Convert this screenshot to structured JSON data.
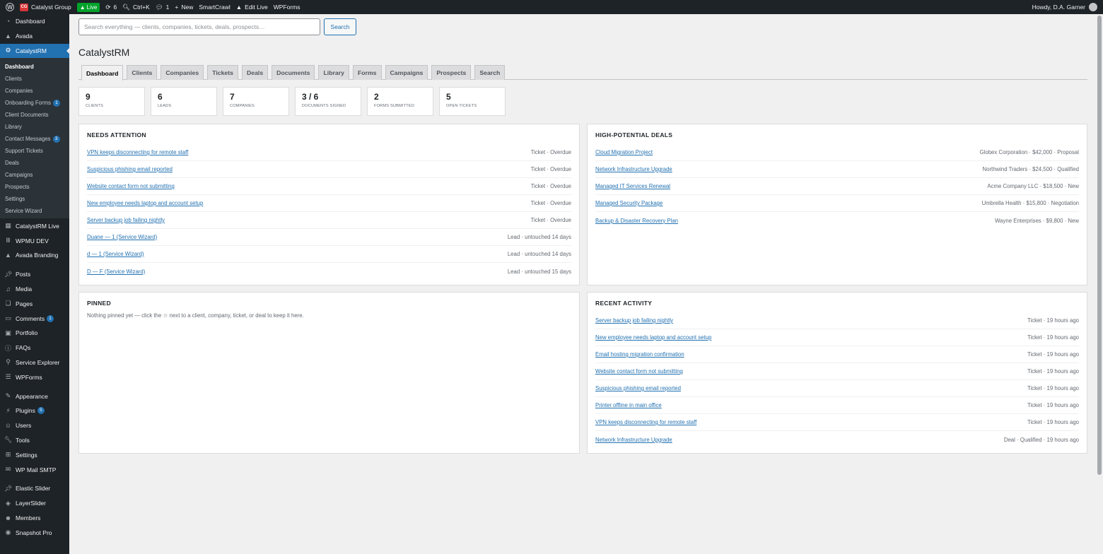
{
  "adminbar": {
    "site_name": "Catalyst Group",
    "live_label": "Live",
    "updates_count": "6",
    "shortcut_label": "Ctrl+K",
    "comments_count": "1",
    "new_label": "New",
    "smartcrawl_label": "SmartCrawl",
    "edit_live_label": "Edit Live",
    "wpforms_label": "WPForms",
    "howdy": "Howdy, D.A. Garner"
  },
  "menu": {
    "dashboard": "Dashboard",
    "avada": "Avada",
    "catalystrm": "CatalystRM",
    "submenu": [
      {
        "label": "Dashboard",
        "badge": ""
      },
      {
        "label": "Clients",
        "badge": ""
      },
      {
        "label": "Companies",
        "badge": ""
      },
      {
        "label": "Onboarding Forms",
        "badge": "1"
      },
      {
        "label": "Client Documents",
        "badge": ""
      },
      {
        "label": "Library",
        "badge": ""
      },
      {
        "label": "Contact Messages",
        "badge": "3"
      },
      {
        "label": "Support Tickets",
        "badge": ""
      },
      {
        "label": "Deals",
        "badge": ""
      },
      {
        "label": "Campaigns",
        "badge": ""
      },
      {
        "label": "Prospects",
        "badge": ""
      },
      {
        "label": "Settings",
        "badge": ""
      },
      {
        "label": "Service Wizard",
        "badge": ""
      }
    ],
    "group1": [
      {
        "label": "CatalystRM Live",
        "icon": "grid-icon"
      },
      {
        "label": "WPMU DEV",
        "icon": "wpmudev-icon"
      },
      {
        "label": "Avada Branding",
        "icon": "avada-icon"
      }
    ],
    "group2": [
      {
        "label": "Posts",
        "icon": "pin-icon",
        "badge": ""
      },
      {
        "label": "Media",
        "icon": "media-icon",
        "badge": ""
      },
      {
        "label": "Pages",
        "icon": "pages-icon",
        "badge": ""
      },
      {
        "label": "Comments",
        "icon": "comments-icon",
        "badge": "1"
      },
      {
        "label": "Portfolio",
        "icon": "portfolio-icon",
        "badge": ""
      },
      {
        "label": "FAQs",
        "icon": "faq-icon",
        "badge": ""
      },
      {
        "label": "Service Explorer",
        "icon": "sitemap-icon",
        "badge": ""
      },
      {
        "label": "WPForms",
        "icon": "forms-icon",
        "badge": ""
      }
    ],
    "group3": [
      {
        "label": "Appearance",
        "icon": "brush-icon",
        "badge": ""
      },
      {
        "label": "Plugins",
        "icon": "plugin-icon",
        "badge": "5"
      },
      {
        "label": "Users",
        "icon": "users-icon",
        "badge": ""
      },
      {
        "label": "Tools",
        "icon": "wrench-icon",
        "badge": ""
      },
      {
        "label": "Settings",
        "icon": "settings-icon",
        "badge": ""
      },
      {
        "label": "WP Mail SMTP",
        "icon": "mail-icon",
        "badge": ""
      }
    ],
    "group4": [
      {
        "label": "Elastic Slider",
        "icon": "pin-icon"
      },
      {
        "label": "LayerSlider",
        "icon": "layers-icon"
      },
      {
        "label": "Members",
        "icon": "members-icon"
      },
      {
        "label": "Snapshot Pro",
        "icon": "snapshot-icon"
      }
    ]
  },
  "search": {
    "placeholder": "Search everything — clients, companies, tickets, deals, prospects…",
    "button": "Search"
  },
  "page_title": "CatalystRM",
  "tabs": [
    "Dashboard",
    "Clients",
    "Companies",
    "Tickets",
    "Deals",
    "Documents",
    "Library",
    "Forms",
    "Campaigns",
    "Prospects",
    "Search"
  ],
  "stats": [
    {
      "value": "9",
      "label": "Clients"
    },
    {
      "value": "6",
      "label": "Leads"
    },
    {
      "value": "7",
      "label": "Companies"
    },
    {
      "value": "3 / 6",
      "label": "Documents signed"
    },
    {
      "value": "2",
      "label": "Forms submitted"
    },
    {
      "value": "5",
      "label": "Open tickets"
    }
  ],
  "needs_attention": {
    "title": "Needs Attention",
    "items": [
      {
        "title": "VPN keeps disconnecting for remote staff",
        "meta": "Ticket · Overdue"
      },
      {
        "title": "Suspicious phishing email reported",
        "meta": "Ticket · Overdue"
      },
      {
        "title": "Website contact form not submitting",
        "meta": "Ticket · Overdue"
      },
      {
        "title": "New employee needs laptop and account setup",
        "meta": "Ticket · Overdue"
      },
      {
        "title": "Server backup job failing nightly",
        "meta": "Ticket · Overdue"
      },
      {
        "title": "Duane — 1 (Service Wizard)",
        "meta": "Lead · untouched 14 days"
      },
      {
        "title": "d — 1 (Service Wizard)",
        "meta": "Lead · untouched 14 days"
      },
      {
        "title": "D — F (Service Wizard)",
        "meta": "Lead · untouched 15 days"
      }
    ]
  },
  "deals": {
    "title": "High-Potential Deals",
    "items": [
      {
        "title": "Cloud Migration Project",
        "meta": "Globex Corporation · $42,000 · Proposal"
      },
      {
        "title": "Network Infrastructure Upgrade",
        "meta": "Northwind Traders · $24,500 · Qualified"
      },
      {
        "title": "Managed IT Services Renewal",
        "meta": "Acme Company LLC · $18,500 · New"
      },
      {
        "title": "Managed Security Package",
        "meta": "Umbrella Health · $15,800 · Negotiation"
      },
      {
        "title": "Backup & Disaster Recovery Plan",
        "meta": "Wayne Enterprises · $9,800 · New"
      }
    ]
  },
  "pinned": {
    "title": "Pinned",
    "empty_text": "Nothing pinned yet — click the ☆ next to a client, company, ticket, or deal to keep it here."
  },
  "activity": {
    "title": "Recent Activity",
    "items": [
      {
        "title": "Server backup job failing nightly",
        "meta": "Ticket · 19 hours ago"
      },
      {
        "title": "New employee needs laptop and account setup",
        "meta": "Ticket · 19 hours ago"
      },
      {
        "title": "Email hosting migration confirmation",
        "meta": "Ticket · 19 hours ago"
      },
      {
        "title": "Website contact form not submitting",
        "meta": "Ticket · 19 hours ago"
      },
      {
        "title": "Suspicious phishing email reported",
        "meta": "Ticket · 19 hours ago"
      },
      {
        "title": "Printer offline in main office",
        "meta": "Ticket · 19 hours ago"
      },
      {
        "title": "VPN keeps disconnecting for remote staff",
        "meta": "Ticket · 19 hours ago"
      },
      {
        "title": "Network Infrastructure Upgrade",
        "meta": "Deal · Qualified · 19 hours ago"
      }
    ]
  }
}
